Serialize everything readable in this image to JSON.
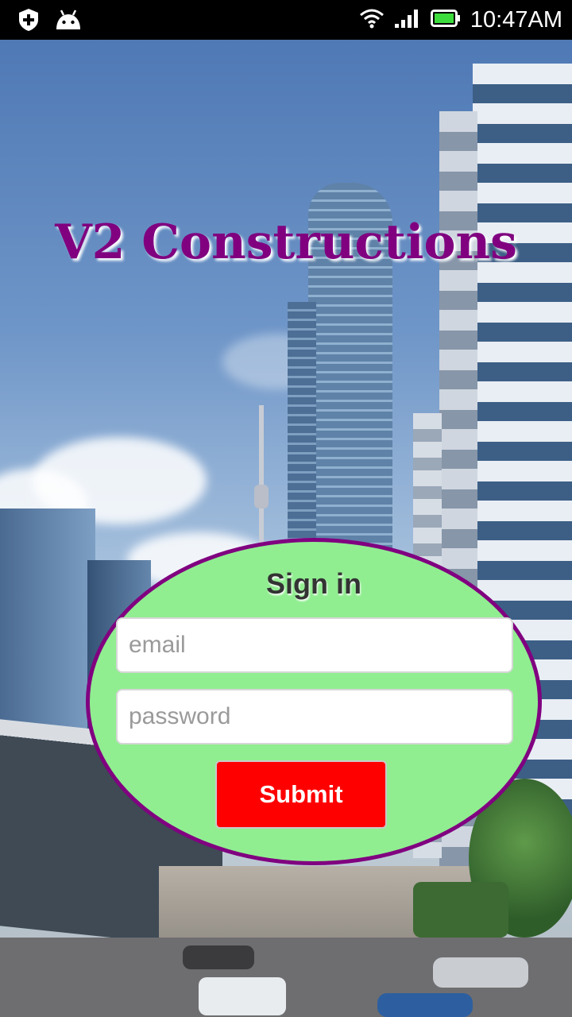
{
  "status_bar": {
    "time": "10:47AM",
    "icons": [
      "shield-plus-icon",
      "android-icon",
      "wifi-icon",
      "signal-icon",
      "battery-icon"
    ]
  },
  "app": {
    "title": "V2 Constructions",
    "title_color": "#800080"
  },
  "signin": {
    "heading": "Sign in",
    "email_placeholder": "email",
    "password_placeholder": "password",
    "submit_label": "Submit",
    "panel_color": "#90ee90",
    "border_color": "#800080",
    "button_color": "#ff0000"
  }
}
